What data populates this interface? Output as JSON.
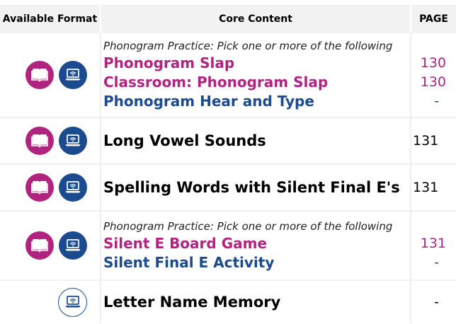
{
  "header": {
    "format": "Available Format",
    "content": "Core Content",
    "page": "PAGE"
  },
  "colors": {
    "magenta": "#b0237f",
    "blue": "#1c4a8e"
  },
  "icons": {
    "book": "book-icon",
    "laptop": "laptop-wifi-icon"
  },
  "rows": [
    {
      "note": "Phonogram Practice: Pick one or more of the following",
      "links": [
        "Phonogram Slap",
        "Classroom: Phonogram Slap",
        "Phonogram Hear and Type"
      ],
      "pages": [
        "130",
        "130",
        "-"
      ]
    },
    {
      "title": "Long Vowel Sounds",
      "page": "131"
    },
    {
      "title": "Spelling Words with Silent Final E's",
      "page": "131"
    },
    {
      "note": "Phonogram Practice: Pick one or more of the following",
      "links": [
        "Silent E Board Game",
        "Silent Final E Activity"
      ],
      "pages": [
        "131",
        "-"
      ]
    },
    {
      "title": "Letter Name Memory",
      "page": "-"
    }
  ]
}
